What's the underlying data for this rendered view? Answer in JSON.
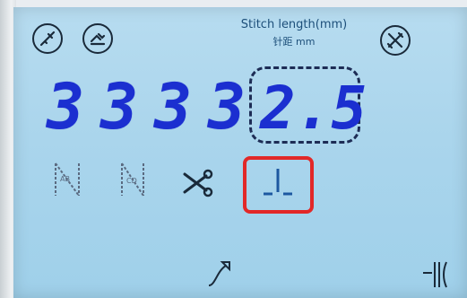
{
  "header": {
    "stitch_length_label": "Stitch length(mm)",
    "stitch_length_label_cn": "针距 mm"
  },
  "digits": [
    "3",
    "3",
    "3",
    "3"
  ],
  "stitch_length_value": "2.5",
  "icons": {
    "top_left_1": "needle-threader-icon",
    "top_left_2": "bobbin-wind-icon",
    "top_right": "tools-settings-icon",
    "row2": [
      "backstitch-ab-icon",
      "backstitch-cd-icon",
      "thread-cut-icon",
      "needle-stop-down-icon"
    ],
    "bottom_left": "presser-foot-lift-icon",
    "bottom_right": "bracket-icon"
  },
  "colors": {
    "lcd_background": "#aad5ec",
    "digit_color": "#1b2fd0",
    "highlight": "#e22828"
  }
}
